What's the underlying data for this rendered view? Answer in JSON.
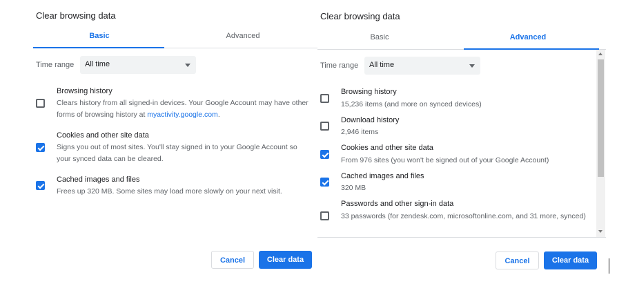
{
  "basic_dialog": {
    "title": "Clear browsing data",
    "tabs": [
      {
        "label": "Basic",
        "active": true
      },
      {
        "label": "Advanced",
        "active": false
      }
    ],
    "time_range": {
      "label": "Time range",
      "value": "All time"
    },
    "items": [
      {
        "title": "Browsing history",
        "desc_before_link": "Clears history from all signed-in devices. Your Google Account may have other forms of browsing history at ",
        "link": "myactivity.google.com",
        "desc_after_link": ".",
        "checked": false
      },
      {
        "title": "Cookies and other site data",
        "desc": "Signs you out of most sites. You'll stay signed in to your Google Account so your synced data can be cleared.",
        "checked": true
      },
      {
        "title": "Cached images and files",
        "desc": "Frees up 320 MB. Some sites may load more slowly on your next visit.",
        "checked": true
      }
    ],
    "buttons": {
      "cancel": "Cancel",
      "clear": "Clear data"
    }
  },
  "advanced_dialog": {
    "title": "Clear browsing data",
    "tabs": [
      {
        "label": "Basic",
        "active": false
      },
      {
        "label": "Advanced",
        "active": true
      }
    ],
    "time_range": {
      "label": "Time range",
      "value": "All time"
    },
    "items": [
      {
        "title": "Browsing history",
        "desc": "15,236 items (and more on synced devices)",
        "checked": false
      },
      {
        "title": "Download history",
        "desc": "2,946 items",
        "checked": false
      },
      {
        "title": "Cookies and other site data",
        "desc": "From 976 sites (you won't be signed out of your Google Account)",
        "checked": true
      },
      {
        "title": "Cached images and files",
        "desc": "320 MB",
        "checked": true
      },
      {
        "title": "Passwords and other sign-in data",
        "desc": "33 passwords (for zendesk.com, microsoftonline.com, and 31 more, synced)",
        "checked": false
      }
    ],
    "buttons": {
      "cancel": "Cancel",
      "clear": "Clear data"
    }
  },
  "colors": {
    "accent": "#1a73e8",
    "text": "#202124",
    "secondary_text": "#5f6368",
    "divider": "#dadce0"
  }
}
